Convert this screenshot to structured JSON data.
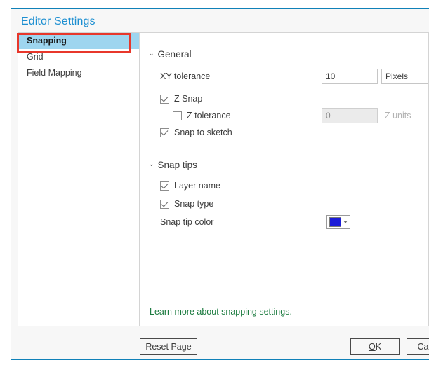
{
  "dialog": {
    "title": "Editor Settings"
  },
  "pages": {
    "items": [
      {
        "label": "Snapping",
        "selected": true
      },
      {
        "label": "Grid",
        "selected": false
      },
      {
        "label": "Field Mapping",
        "selected": false
      }
    ]
  },
  "annotation": {
    "color": "#e8372b",
    "target": "Snapping"
  },
  "general": {
    "header": "General",
    "chevron": "⌄",
    "xy_tolerance_label": "XY tolerance",
    "xy_tolerance_value": "10",
    "xy_units_value": "Pixels",
    "z_snap_label": "Z Snap",
    "z_snap_checked": true,
    "z_tolerance_label": "Z tolerance",
    "z_tolerance_checked": false,
    "z_tolerance_value": "0",
    "z_units_suffix": "Z units",
    "snap_to_sketch_label": "Snap to sketch",
    "snap_to_sketch_checked": true
  },
  "snap_tips": {
    "header": "Snap tips",
    "chevron": "⌄",
    "layer_name_label": "Layer name",
    "layer_name_checked": true,
    "snap_type_label": "Snap type",
    "snap_type_checked": true,
    "snap_tip_color_label": "Snap tip color",
    "snap_tip_color_value": "#1c1cd8"
  },
  "help": {
    "link_text": "Learn more about snapping settings."
  },
  "footer": {
    "reset_label": "Reset Page",
    "ok_accel": "O",
    "ok_rest": "K",
    "cancel_label": "Cancel"
  },
  "colors": {
    "dialog_border": "#1081b8",
    "title": "#1d8fd1",
    "selection": "#9ed5ef",
    "link": "#1a7a3e"
  }
}
